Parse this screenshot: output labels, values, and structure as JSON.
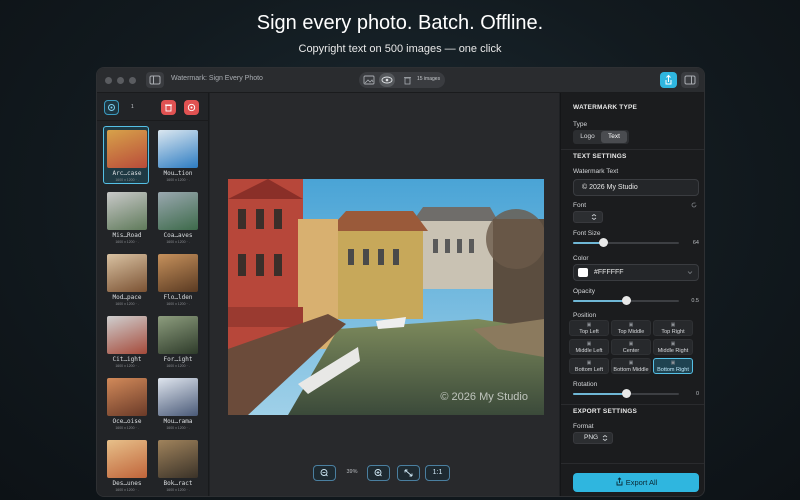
{
  "hero": {
    "title": "Sign every photo. Batch. Offline.",
    "subtitle": "Copyright text on 500 images — one click"
  },
  "window": {
    "title": "Watermark: Sign Every Photo",
    "image_count": "15 images"
  },
  "sidebar": {
    "selection_count": "1",
    "items": [
      {
        "label": "Arc…case",
        "meta": "1600 x 1200 · .",
        "selected": true
      },
      {
        "label": "Mou…tion",
        "meta": "1600 x 1200 · .",
        "selected": false
      },
      {
        "label": "Mis…Road",
        "meta": "1600 x 1200 · .",
        "selected": false
      },
      {
        "label": "Coa…aves",
        "meta": "1600 x 1200 · .",
        "selected": false
      },
      {
        "label": "Mod…pace",
        "meta": "1600 x 1200 · .",
        "selected": false
      },
      {
        "label": "Flo…lden",
        "meta": "1600 x 1200 · .",
        "selected": false
      },
      {
        "label": "Cit…ight",
        "meta": "1600 x 1200 · .",
        "selected": false
      },
      {
        "label": "For…ight",
        "meta": "1600 x 1200 · .",
        "selected": false
      },
      {
        "label": "Oce…oise",
        "meta": "1600 x 1200 · .",
        "selected": false
      },
      {
        "label": "Mou…rama",
        "meta": "1600 x 1200 · .",
        "selected": false
      },
      {
        "label": "Des…unes",
        "meta": "1600 x 1200 · .",
        "selected": false
      },
      {
        "label": "Bok…ract",
        "meta": "1600 x 1200 · .",
        "selected": false
      }
    ]
  },
  "canvas": {
    "watermark_text": "© 2026 My Studio",
    "zoom": "39%",
    "actual_size_label": "1:1"
  },
  "panel": {
    "watermark_type_title": "WATERMARK TYPE",
    "type_label": "Type",
    "type_options": [
      "Logo",
      "Text"
    ],
    "type_selected": "Text",
    "text_settings_title": "TEXT SETTINGS",
    "watermark_text_label": "Watermark Text",
    "watermark_text_value": "© 2026 My Studio",
    "font_label": "Font",
    "font_size_label": "Font Size",
    "font_size_value": "64",
    "font_size_fraction": 0.29,
    "color_label": "Color",
    "color_value": "#FFFFFF",
    "opacity_label": "Opacity",
    "opacity_value": "0.5",
    "opacity_fraction": 0.5,
    "position_label": "Position",
    "positions": [
      "Top Left",
      "Top Middle",
      "Top Right",
      "Middle Left",
      "Center",
      "Middle Right",
      "Bottom Left",
      "Bottom Middle",
      "Bottom Right"
    ],
    "position_selected": "Bottom Right",
    "rotation_label": "Rotation",
    "rotation_value": "0",
    "rotation_fraction": 0.5,
    "export_settings_title": "EXPORT SETTINGS",
    "format_label": "Format",
    "format_value": "PNG",
    "export_button": "Export All"
  },
  "colors": {
    "accent": "#2fb6df",
    "delete_red": "#e05252",
    "background": "#1f2124"
  }
}
